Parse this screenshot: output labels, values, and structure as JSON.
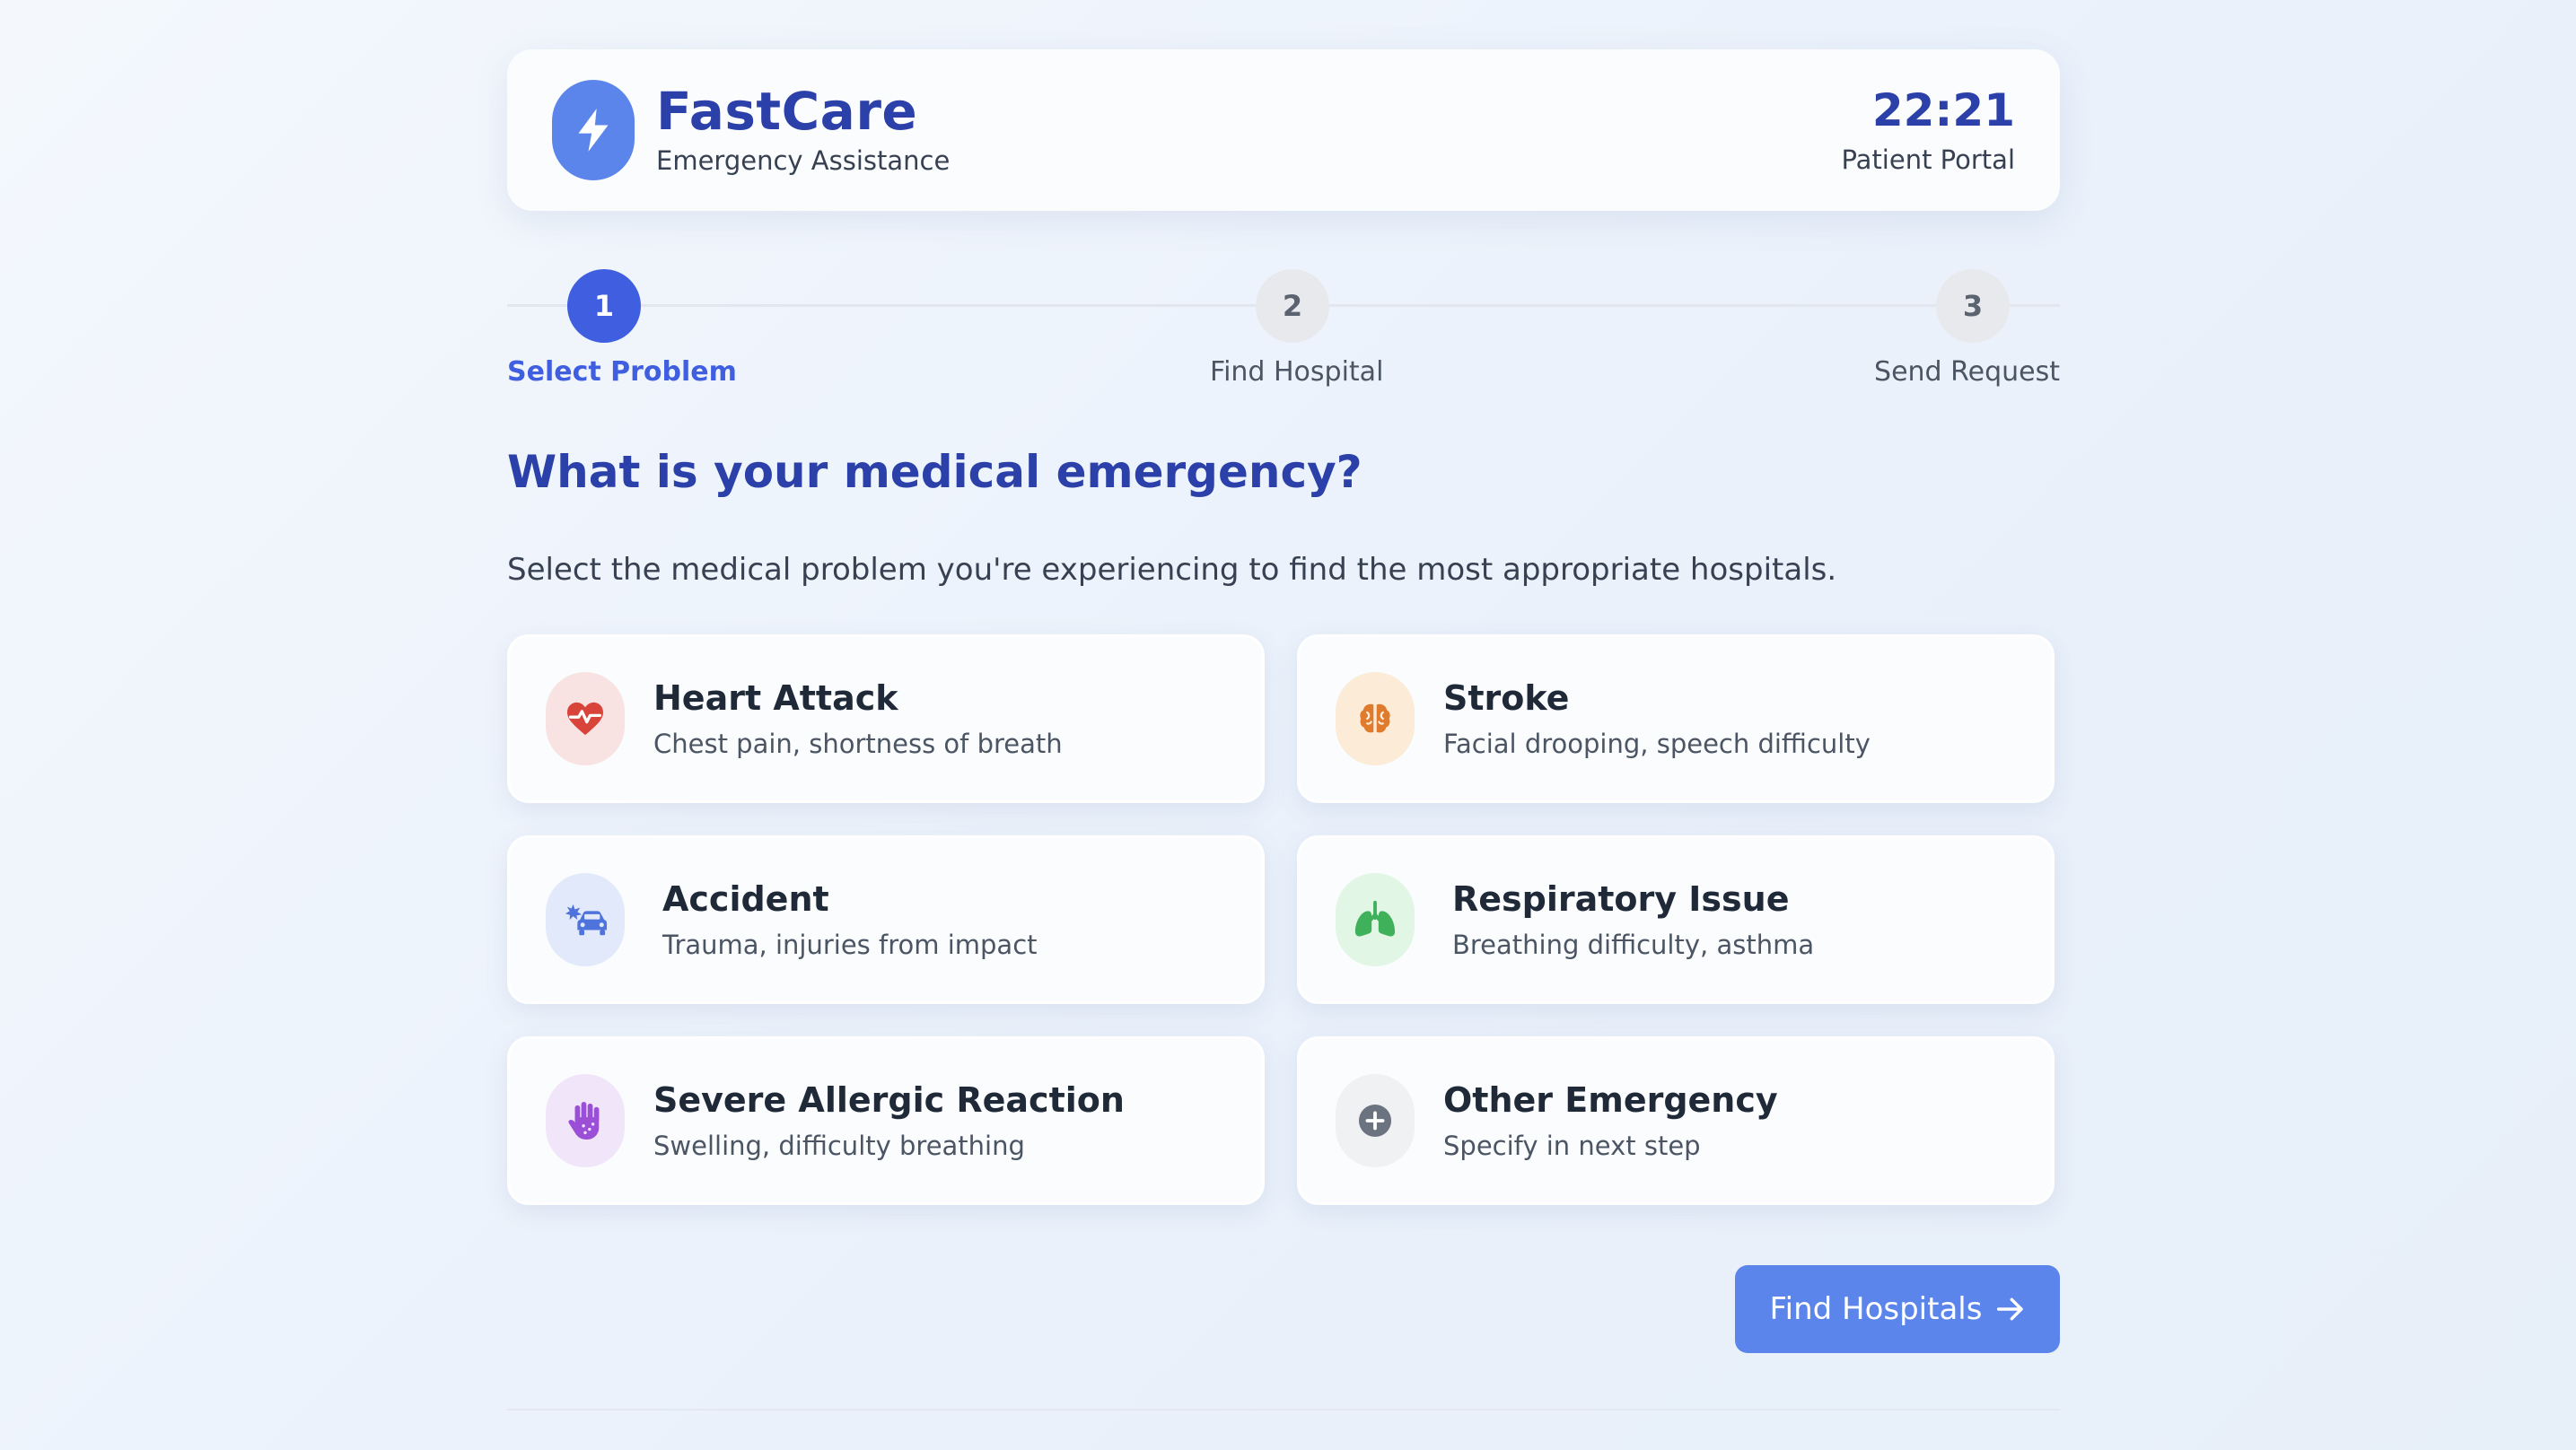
{
  "header": {
    "brand_name": "FastCare",
    "brand_subtitle": "Emergency Assistance",
    "logo_icon": "lightning-bolt-icon",
    "time": "22:21",
    "portal_label": "Patient Portal"
  },
  "stepper": {
    "current_step": 1,
    "steps": [
      {
        "number": "1",
        "label": "Select Problem",
        "state": "active"
      },
      {
        "number": "2",
        "label": "Find Hospital",
        "state": "inactive"
      },
      {
        "number": "3",
        "label": "Send Request",
        "state": "inactive"
      }
    ]
  },
  "main": {
    "title": "What is your medical emergency?",
    "subtitle": "Select the medical problem you're experiencing to find the most appropriate hospitals.",
    "problems": [
      {
        "title": "Heart Attack",
        "description": "Chest pain, shortness of breath",
        "icon": "heart-pulse-icon",
        "icon_color": "#d9443a",
        "icon_bg": "#f9e2e2"
      },
      {
        "title": "Stroke",
        "description": "Facial drooping, speech difficulty",
        "icon": "brain-icon",
        "icon_color": "#e07a2c",
        "icon_bg": "#fbebd7"
      },
      {
        "title": "Accident",
        "description": "Trauma, injuries from impact",
        "icon": "car-crash-icon",
        "icon_color": "#4f73dc",
        "icon_bg": "#e1e9fb"
      },
      {
        "title": "Respiratory Issue",
        "description": "Breathing difficulty, asthma",
        "icon": "lungs-icon",
        "icon_color": "#3fb15a",
        "icon_bg": "#e2f6e6"
      },
      {
        "title": "Severe Allergic Reaction",
        "description": "Swelling, difficulty breathing",
        "icon": "allergy-hand-icon",
        "icon_color": "#9b4fd6",
        "icon_bg": "#f1e5fa"
      },
      {
        "title": "Other Emergency",
        "description": "Specify in next step",
        "icon": "plus-circle-icon",
        "icon_color": "#6b7280",
        "icon_bg": "#f0f1f3"
      }
    ],
    "submit_label": "Find Hospitals"
  },
  "colors": {
    "primary": "#2b40a8",
    "accent": "#3f5fe0",
    "button": "#5b85ea"
  }
}
